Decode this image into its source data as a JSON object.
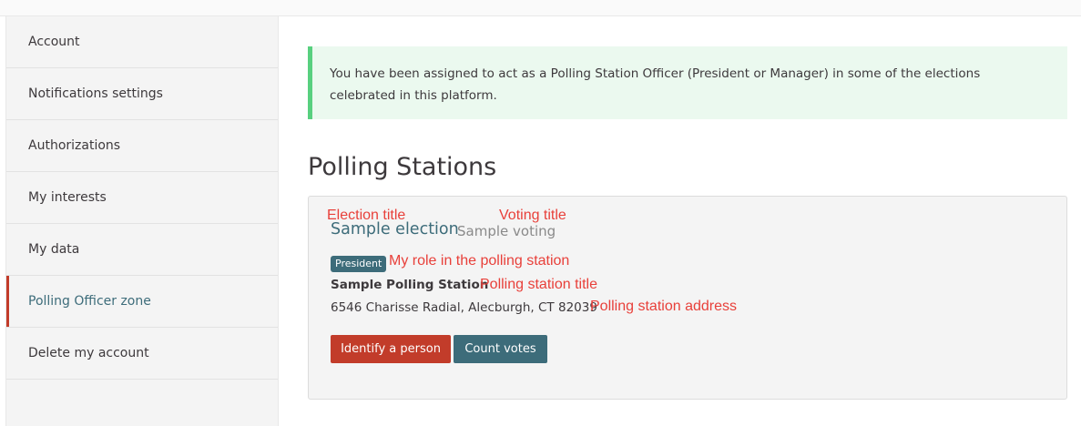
{
  "sidebar": {
    "items": [
      {
        "label": "Account",
        "active": false
      },
      {
        "label": "Notifications settings",
        "active": false
      },
      {
        "label": "Authorizations",
        "active": false
      },
      {
        "label": "My interests",
        "active": false
      },
      {
        "label": "My data",
        "active": false
      },
      {
        "label": "Polling Officer zone",
        "active": true
      },
      {
        "label": "Delete my account",
        "active": false
      }
    ]
  },
  "alert": {
    "text": "You have been assigned to act as a Polling Station Officer (President or Manager) in some of the elections celebrated in this platform."
  },
  "main": {
    "title": "Polling Stations"
  },
  "station": {
    "election_title": "Sample election",
    "voting_title": "Sample voting",
    "role_badge": "President",
    "title": "Sample Polling Station",
    "address": "6546 Charisse Radial, Alecburgh, CT 82039",
    "identify_button": "Identify a person",
    "count_button": "Count votes"
  },
  "annotations": {
    "election_title": "Election title",
    "voting_title": "Voting title",
    "role": "My role in the polling station",
    "station_title": "Polling station title",
    "station_address": "Polling station address"
  },
  "colors": {
    "accent_teal": "#3d6c7a",
    "danger_red": "#c23c2a",
    "success_green": "#58d07f",
    "annotation_red": "#e8403a"
  }
}
